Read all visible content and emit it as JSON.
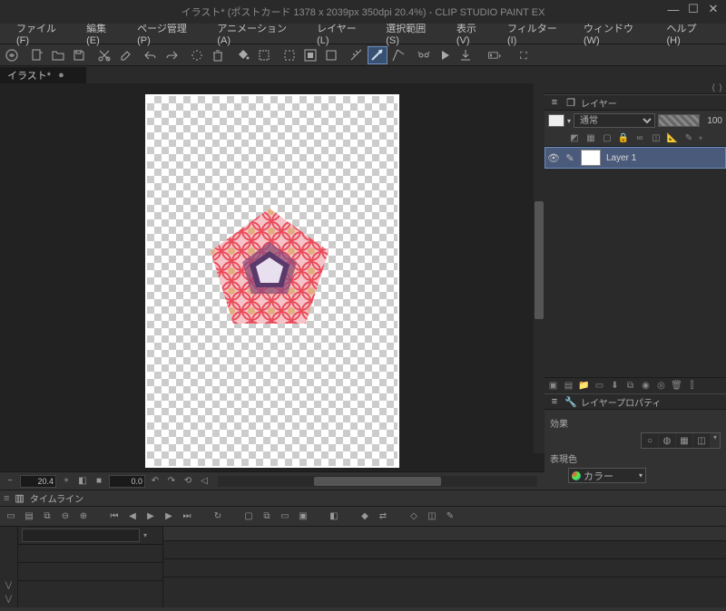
{
  "title": "イラスト* (ポストカード 1378 x 2039px 350dpi 20.4%)   - CLIP STUDIO PAINT EX",
  "menu": {
    "file": "ファイル(F)",
    "edit": "編集(E)",
    "page": "ページ管理(P)",
    "animation": "アニメーション(A)",
    "layer": "レイヤー(L)",
    "select": "選択範囲(S)",
    "view": "表示(V)",
    "filter": "フィルター(I)",
    "window": "ウィンドウ(W)",
    "help": "ヘルプ(H)"
  },
  "tab": {
    "name": "イラスト*",
    "dirty": "●"
  },
  "status": {
    "zoom": "20.4",
    "rotate": "0.0"
  },
  "layer_panel": {
    "title": "レイヤー",
    "blend": "通常",
    "opacity": "100",
    "layers": [
      {
        "name": "Layer  1"
      }
    ]
  },
  "layer_prop": {
    "title": "レイヤープロパティ",
    "effect_label": "効果",
    "color_mode_label": "表現色",
    "color_mode": "カラー"
  },
  "timeline": {
    "title": "タイムライン"
  }
}
